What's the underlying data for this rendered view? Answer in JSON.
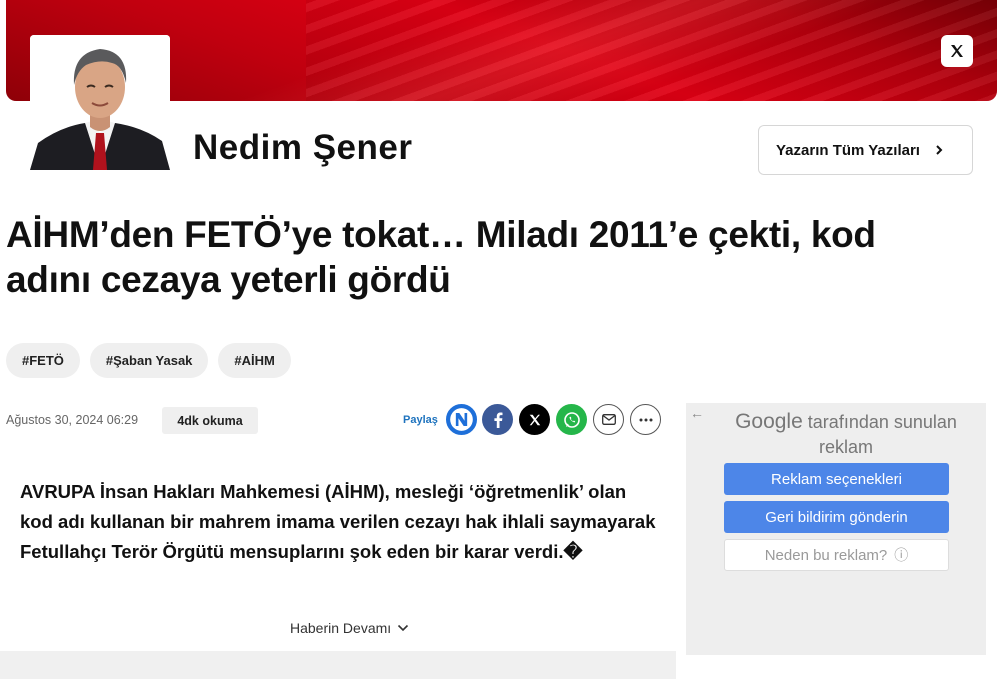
{
  "header": {
    "x_icon": "x-logo-icon",
    "author_name": "Nedim Şener",
    "all_posts_label": "Yazarın Tüm Yazıları",
    "brand_red": "#d0000f"
  },
  "article": {
    "headline": "AİHM’den FETÖ’ye tokat… Miladı 2011’e çekti, kod adını cezaya yeterli gördü",
    "tags": [
      "#FETÖ",
      "#Şaban Yasak",
      "#AİHM"
    ],
    "date": "Ağustos 30, 2024 06:29",
    "read_time": "4dk okuma",
    "share_label": "Paylaş",
    "share_icons": [
      "news-n-icon",
      "facebook-icon",
      "x-icon",
      "whatsapp-icon",
      "email-icon",
      "more-icon"
    ],
    "lead": "AVRUPA İnsan Hakları Mahkemesi (AİHM), mesleği ‘öğretmenlik’ olan kod adı kullanan bir mahrem imama verilen cezayı hak ihlali saymayarak Fetullahçı Terör Örgütü mensuplarını şok eden bir karar verdi.�",
    "more_label": "Haberin Devamı"
  },
  "ad": {
    "back_arrow": "←",
    "google": "Google",
    "heading_rest": "tarafından sunulan reklam",
    "btn_options": "Reklam seçenekleri",
    "btn_feedback": "Geri bildirim gönderin",
    "btn_why": "Neden bu reklam?",
    "info_glyph": "ⓘ"
  }
}
